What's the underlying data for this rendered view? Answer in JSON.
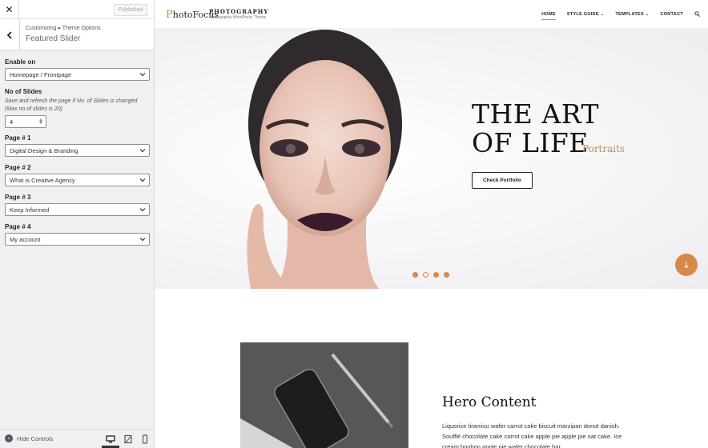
{
  "customizer": {
    "close_icon": "close-icon",
    "published_label": "Published",
    "breadcrumb": "Customizing ▸ Theme Options",
    "section_title": "Featured Slider",
    "enable_on": {
      "label": "Enable on",
      "value": "Homepage / Frontpage"
    },
    "no_of_slides": {
      "label": "No of Slides",
      "description": "Save and refresh the page if No. of Slides is changed (Max no of slides is 20)",
      "value": "4"
    },
    "pages": [
      {
        "label": "Page # 1",
        "value": "Digital Design & Branding"
      },
      {
        "label": "Page # 2",
        "value": "What is Creative Agency"
      },
      {
        "label": "Page # 3",
        "value": "Keep Informed"
      },
      {
        "label": "Page # 4",
        "value": "My account"
      }
    ],
    "footer": {
      "hide_controls_label": "Hide Controls",
      "devices": [
        "desktop-icon",
        "tablet-icon",
        "mobile-icon"
      ],
      "active_device": "desktop"
    }
  },
  "site": {
    "logo_text": "PhotoFocus",
    "title": "PHOTOGRAPHY",
    "description": "Photography WordPress Theme",
    "nav": [
      {
        "label": "HOME",
        "active": true,
        "has_dropdown": false
      },
      {
        "label": "STYLE GUIDE",
        "active": false,
        "has_dropdown": true
      },
      {
        "label": "TEMPLATES",
        "active": false,
        "has_dropdown": true
      },
      {
        "label": "CONTACT",
        "active": false,
        "has_dropdown": false
      }
    ],
    "hero": {
      "heading_line1": "THE ART",
      "heading_line2": "OF LIFE",
      "accent": "Portraits",
      "button_label": "Check Portfolio",
      "slides_total": 4,
      "active_slide": 2
    },
    "content": {
      "title": "Hero Content",
      "text": "Liquorice tiramisu wafer carrot cake biscuit marzipan donut danish. Soufflé chocolate cake carrot cake apple pie apple pie oat cake. Ice cream bonbon apple pie wafer chocolate bar."
    }
  },
  "colors": {
    "accent": "#d7894a",
    "panel_bg": "#f0f0f1",
    "border": "#dcdcde"
  }
}
